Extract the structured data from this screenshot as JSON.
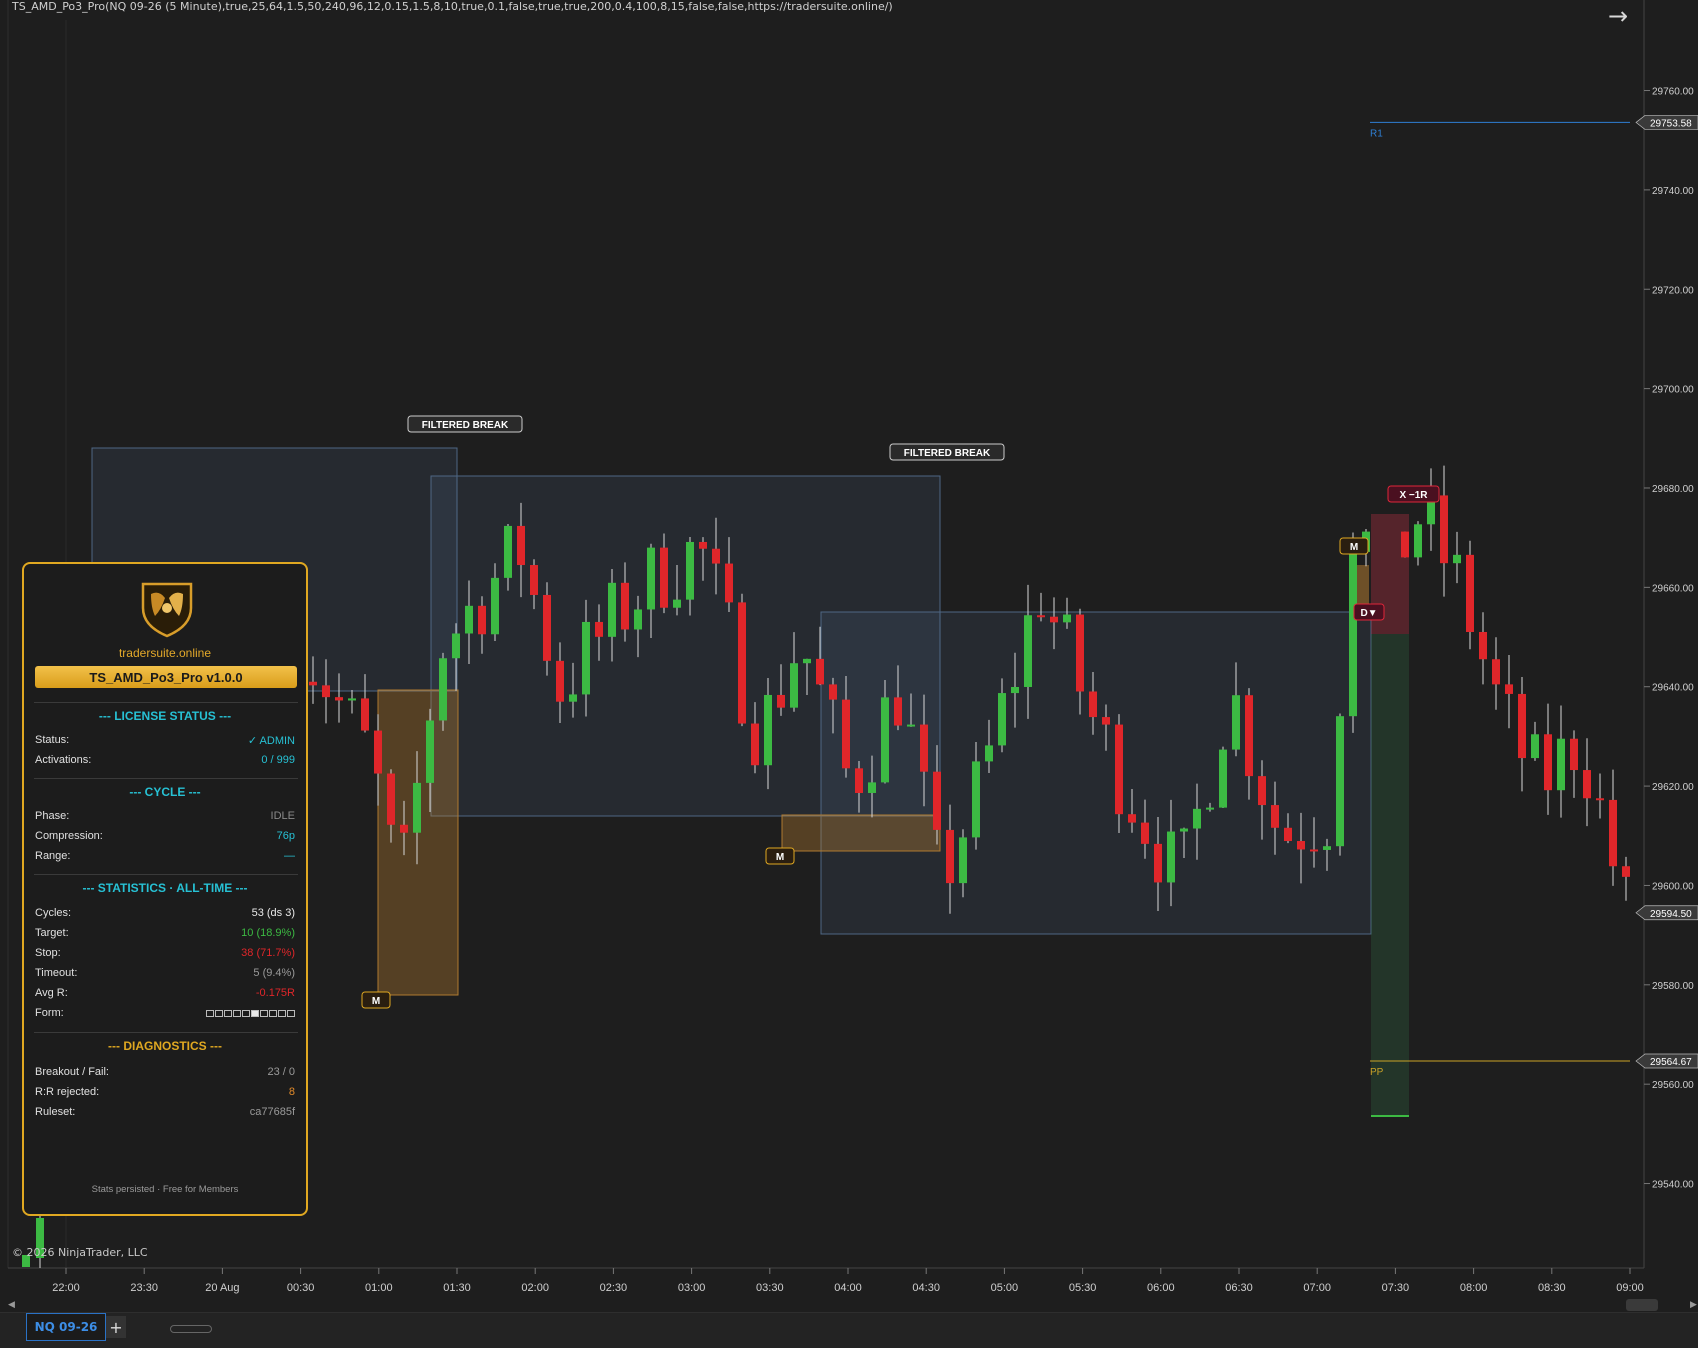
{
  "window": {
    "indicator_title": "TS_AMD_Po3_Pro(NQ 09-26 (5 Minute),true,25,64,1.5,50,240,96,12,0.15,1.5,8,10,true,0.1,false,true,true,200,0.4,100,8,15,false,false,https://tradersuite.online/)",
    "copyright": "© 2026 NinjaTrader, LLC",
    "arrow_icon": "arrow-right-icon"
  },
  "tabs": {
    "active": "NQ 09-26",
    "add_label": "+"
  },
  "chart_data": {
    "type": "candlestick",
    "instrument": "NQ 09-26",
    "ylim": [
      29523,
      29775
    ],
    "y_ticks": [
      29760,
      29740,
      29720,
      29700,
      29680,
      29660,
      29640,
      29620,
      29600,
      29580,
      29560,
      29540
    ],
    "x_ticks": [
      "22:00",
      "23:30",
      "20 Aug",
      "00:30",
      "01:00",
      "01:30",
      "02:00",
      "02:30",
      "03:00",
      "03:30",
      "04:00",
      "04:30",
      "05:00",
      "05:30",
      "06:00",
      "06:30",
      "07:00",
      "07:30",
      "08:00",
      "08:30",
      "09:00"
    ],
    "last_price": "29594.50",
    "levels": [
      {
        "label": "R1",
        "value": 29753.58,
        "value_text": "29753.58",
        "color": "#2f7fd4"
      },
      {
        "label": "PP",
        "value": 29564.67,
        "value_text": "29564.67",
        "color": "#c9a227"
      }
    ],
    "annotations": [
      "FILTERED BREAK",
      "FILTERED BREAK",
      "M",
      "M",
      "M",
      "X −1R",
      "D▼"
    ],
    "colors": {
      "up": "#3cba43",
      "down": "#e0262a",
      "wick": "#d8d8d8"
    }
  },
  "panel": {
    "brand": "tradersuite.online",
    "version": "TS_AMD_Po3_Pro v1.0.0",
    "logo_icon": "shield-bull-bear-logo-icon",
    "license": {
      "title": "--- LICENSE STATUS ---",
      "rows": [
        {
          "label": "Status:",
          "value": "✓ ADMIN"
        },
        {
          "label": "Activations:",
          "value": "0 / 999"
        }
      ]
    },
    "cycle": {
      "title": "--- CYCLE ---",
      "rows": [
        {
          "label": "Phase:",
          "value": "IDLE"
        },
        {
          "label": "Compression:",
          "value": "76p"
        },
        {
          "label": "Range:",
          "value": "—"
        }
      ]
    },
    "statistics": {
      "title": "--- STATISTICS · ALL-TIME ---",
      "cycles": {
        "label": "Cycles:",
        "value": "53 (ds 3)"
      },
      "target": {
        "label": "Target:",
        "value": "10",
        "pct": "(18.9%)"
      },
      "stop": {
        "label": "Stop:",
        "value": "38",
        "pct": "(71.7%)"
      },
      "timeout": {
        "label": "Timeout:",
        "value": "5",
        "pct": "(9.4%)"
      },
      "avg_r": {
        "label": "Avg R:",
        "value": "-0.175R"
      },
      "form": {
        "label": "Form:"
      }
    },
    "diagnostics": {
      "title": "--- DIAGNOSTICS ---",
      "rows": [
        {
          "label": "Breakout / Fail:",
          "value": "23 / 0"
        },
        {
          "label": "R:R rejected:",
          "value": "8"
        },
        {
          "label": "Ruleset:",
          "value": "ca77685f"
        }
      ]
    },
    "footer": "Stats persisted · Free for Members",
    "colors": {
      "accent": "#e0a821",
      "cyan": "#27c1d4",
      "green": "#3cba43",
      "red": "#e0262a",
      "orange": "#e08a2a"
    }
  }
}
